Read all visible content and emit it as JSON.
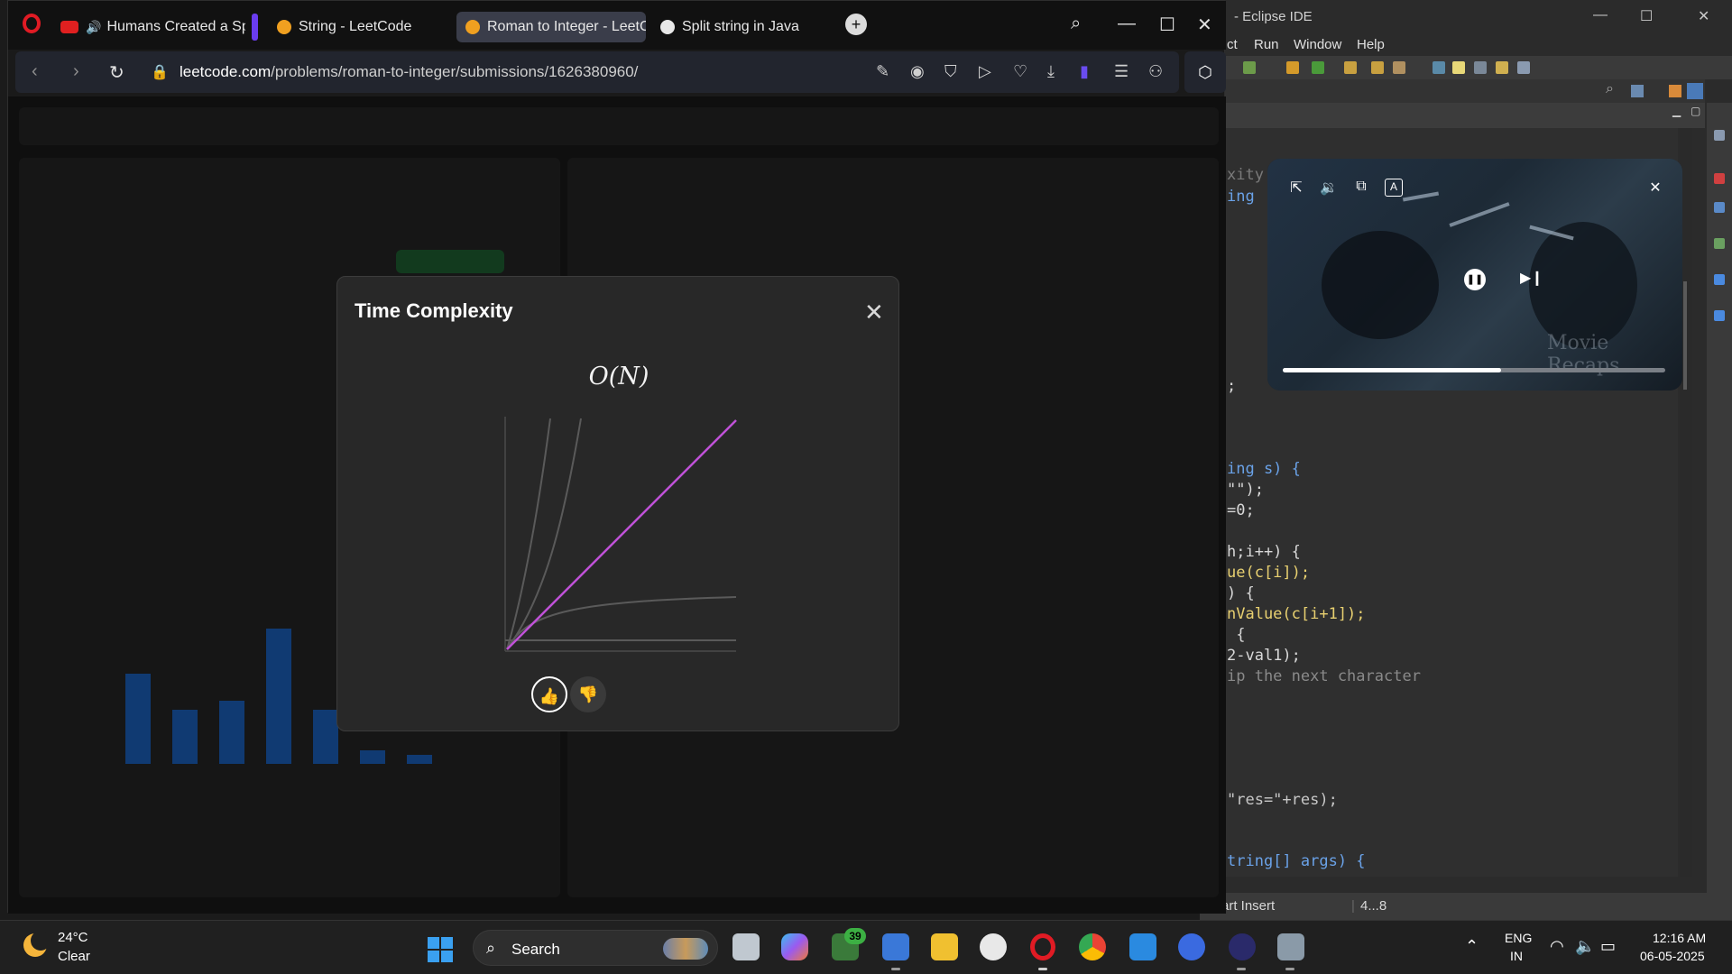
{
  "eclipse": {
    "title": "- Eclipse IDE",
    "menu": [
      "ct",
      "Run",
      "Window",
      "Help"
    ],
    "code_lines": [
      {
        "text": "xity",
        "cls": "dimtext"
      },
      {
        "text": "ing",
        "cls": "type"
      },
      {
        "text": ";",
        "cls": "plain"
      },
      {
        "text": "ing s) {",
        "cls": "type"
      },
      {
        "text": "\"\");",
        "cls": "plain"
      },
      {
        "text": "=0;",
        "cls": "plain"
      },
      {
        "text": "h;i++) {",
        "cls": "plain"
      },
      {
        "text": "ue(c[i]);",
        "cls": "plain"
      },
      {
        "text": ") {",
        "cls": "plain"
      },
      {
        "text": "nValue(c[i+1]);",
        "cls": "plain"
      },
      {
        "text": " {",
        "cls": "plain"
      },
      {
        "text": "2-val1);",
        "cls": "plain"
      },
      {
        "text": "ip the next character",
        "cls": "comment"
      },
      {
        "text": "\"res=\"+res);",
        "cls": "plain"
      },
      {
        "text": "tring[] args) {",
        "cls": "type"
      }
    ],
    "status": {
      "mode": "art Insert",
      "pos": "4...8"
    }
  },
  "browser": {
    "tabs": [
      {
        "label": "Humans Created a Spa",
        "fav": "#e02020",
        "active": false
      },
      {
        "label": "String - LeetCode",
        "fav": "#f0a020",
        "active": false
      },
      {
        "label": "Roman to Integer - LeetCo",
        "fav": "#f0a020",
        "active": true
      },
      {
        "label": "Split string in Java",
        "fav": "#e8e8e8",
        "active": false
      }
    ],
    "url_host": "leetcode.com",
    "url_path": "/problems/roman-to-integer/submissions/1626380960/"
  },
  "modal": {
    "title": "Time Complexity",
    "complexity": "O(N)",
    "accent": "#c051d8"
  },
  "pip": {
    "watermark": "Movie Recaps",
    "progress": 0.57
  },
  "taskbar": {
    "temp": "24°C",
    "condition": "Clear",
    "search_label": "Search",
    "badge_count": "39",
    "lang_top": "ENG",
    "lang_bottom": "IN",
    "time": "12:16 AM",
    "date": "06-05-2025"
  }
}
